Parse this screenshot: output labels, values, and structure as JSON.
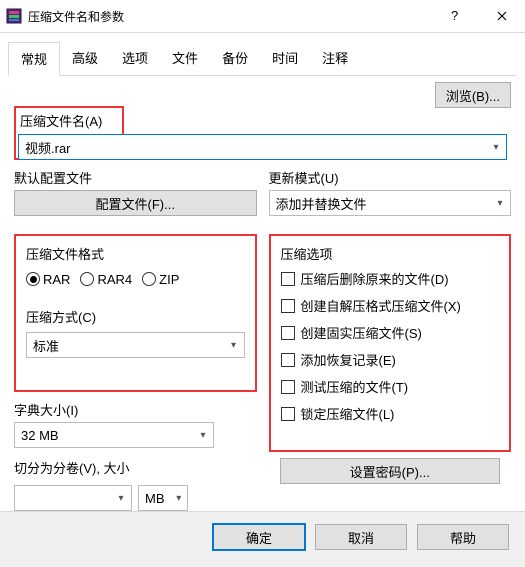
{
  "window": {
    "title": "压缩文件名和参数"
  },
  "tabs": [
    "常规",
    "高级",
    "选项",
    "文件",
    "备份",
    "时间",
    "注释"
  ],
  "browse_label": "浏览(B)...",
  "filename": {
    "label": "压缩文件名(A)",
    "value": "视频.rar"
  },
  "default_profile": {
    "label": "默认配置文件",
    "button": "配置文件(F)..."
  },
  "update_mode": {
    "label": "更新模式(U)",
    "value": "添加并替换文件"
  },
  "format": {
    "label": "压缩文件格式",
    "options": [
      "RAR",
      "RAR4",
      "ZIP"
    ],
    "selected": "RAR"
  },
  "method": {
    "label": "压缩方式(C)",
    "value": "标准"
  },
  "options": {
    "label": "压缩选项",
    "items": [
      "压缩后删除原来的文件(D)",
      "创建自解压格式压缩文件(X)",
      "创建固实压缩文件(S)",
      "添加恢复记录(E)",
      "测试压缩的文件(T)",
      "锁定压缩文件(L)"
    ]
  },
  "dict": {
    "label": "字典大小(I)",
    "value": "32 MB"
  },
  "split": {
    "label": "切分为分卷(V), 大小",
    "unit": "MB"
  },
  "setpwd": "设置密码(P)...",
  "footer": {
    "ok": "确定",
    "cancel": "取消",
    "help": "帮助"
  }
}
